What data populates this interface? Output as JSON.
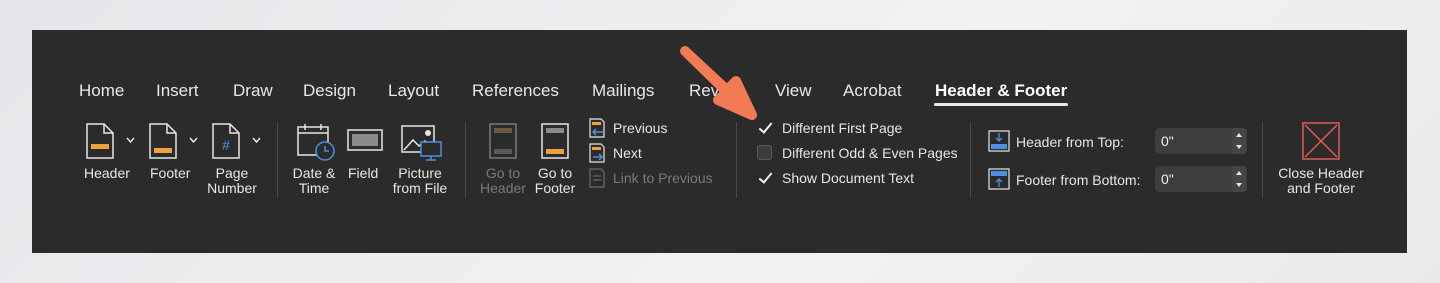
{
  "tabs": [
    {
      "label": "Home"
    },
    {
      "label": "Insert"
    },
    {
      "label": "Draw"
    },
    {
      "label": "Design"
    },
    {
      "label": "Layout"
    },
    {
      "label": "References"
    },
    {
      "label": "Mailings"
    },
    {
      "label": "Rev"
    },
    {
      "label": "View"
    },
    {
      "label": "Acrobat"
    },
    {
      "label": "Header & Footer"
    }
  ],
  "header_footer_group": {
    "header": {
      "label": "Header"
    },
    "footer": {
      "label": "Footer"
    },
    "page_number": {
      "line1": "Page",
      "line2": "Number"
    }
  },
  "insert_group": {
    "date_time": {
      "line1": "Date &",
      "line2": "Time"
    },
    "field": {
      "label": "Field"
    },
    "picture": {
      "line1": "Picture",
      "line2": "from File"
    }
  },
  "navigation_group": {
    "go_to_header": {
      "line1": "Go to",
      "line2": "Header",
      "enabled": false
    },
    "go_to_footer": {
      "line1": "Go to",
      "line2": "Footer",
      "enabled": true
    },
    "previous": {
      "label": "Previous"
    },
    "next": {
      "label": "Next"
    },
    "link_to_previous": {
      "label": "Link to Previous",
      "enabled": false
    }
  },
  "options_group": {
    "different_first_page": {
      "label": "Different First Page",
      "checked": true
    },
    "different_odd_even": {
      "label": "Different Odd & Even Pages",
      "checked": false
    },
    "show_document_text": {
      "label": "Show Document Text",
      "checked": true
    }
  },
  "position_group": {
    "header_from_top": {
      "label": "Header from Top:",
      "value": "0\""
    },
    "footer_from_bottom": {
      "label": "Footer from Bottom:",
      "value": "0\""
    }
  },
  "close_group": {
    "close": {
      "line1": "Close Header",
      "line2": "and Footer"
    }
  },
  "annotation": {
    "type": "arrow",
    "color": "#f27a54"
  },
  "colors": {
    "ribbon_bg": "#2b2b2b",
    "text": "#e6e6e6",
    "accent_orange": "#f0a23a",
    "accent_blue": "#4a90e2",
    "close_red": "#e05a5a"
  }
}
